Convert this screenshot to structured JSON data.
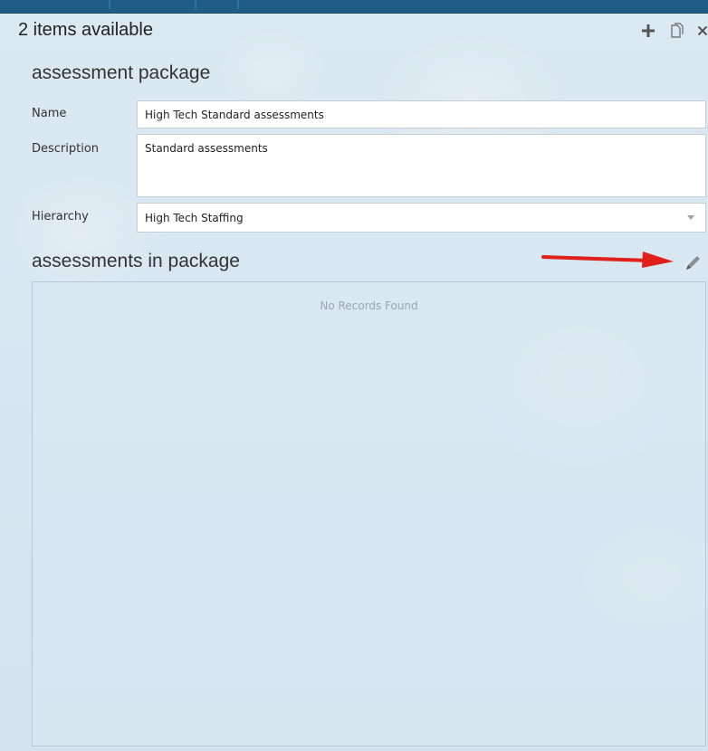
{
  "header": {
    "title": "2 items available",
    "toolbar": {
      "add_icon": "plus-icon",
      "copy_icon": "copy-icon",
      "close_icon": "close-icon"
    }
  },
  "package_section": {
    "title": "assessment package",
    "name": {
      "label": "Name",
      "value": "High Tech Standard assessments"
    },
    "description": {
      "label": "Description",
      "value": "Standard assessments"
    },
    "hierarchy": {
      "label": "Hierarchy",
      "value": "High Tech Staffing"
    }
  },
  "assessments_section": {
    "title": "assessments in package",
    "edit_icon": "pencil-icon",
    "empty_text": "No Records Found"
  },
  "colors": {
    "top_bar": "#1f5d86",
    "background": "#d8e7f0",
    "annotation_arrow": "#e0201b"
  }
}
